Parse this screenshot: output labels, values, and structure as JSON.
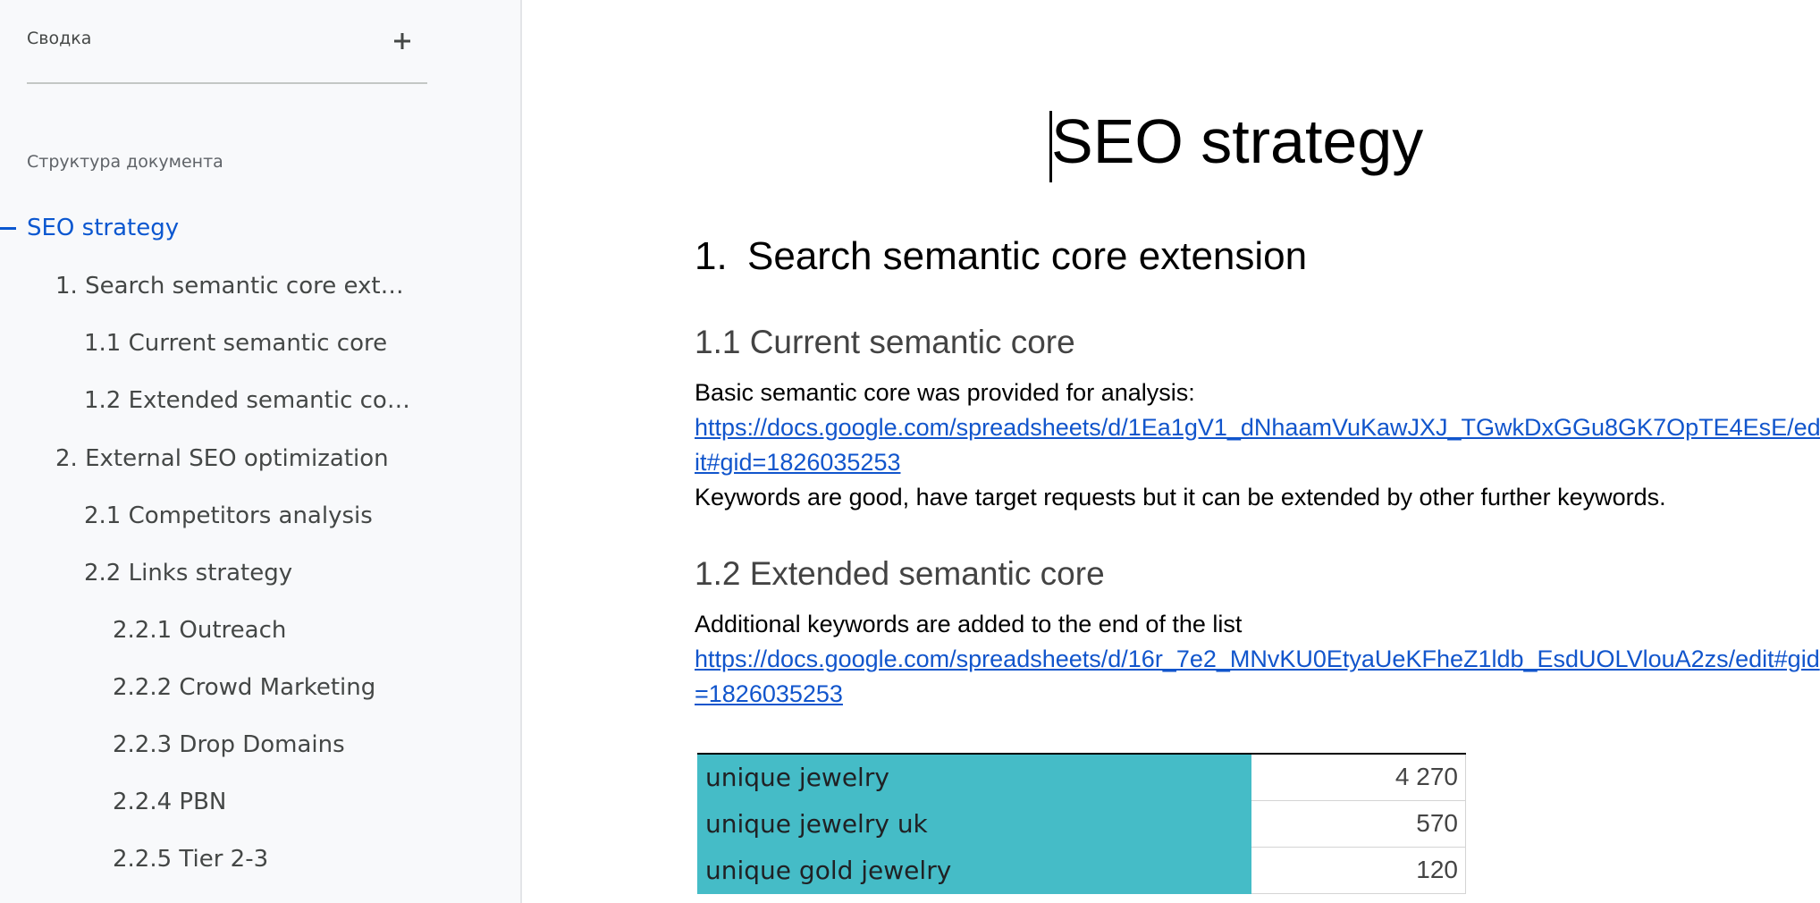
{
  "sidebar": {
    "summary_label": "Сводка",
    "add_icon": "plus-icon",
    "outline_title": "Структура документа",
    "outline": [
      {
        "label": "SEO strategy",
        "level": 0,
        "active": true
      },
      {
        "label": "1. Search semantic core ext…",
        "level": 1
      },
      {
        "label": "1.1 Current semantic core",
        "level": 2
      },
      {
        "label": "1.2 Extended semantic co…",
        "level": 2
      },
      {
        "label": "2. External SEO optimization",
        "level": 1
      },
      {
        "label": "2.1 Competitors analysis",
        "level": 2
      },
      {
        "label": "2.2 Links strategy",
        "level": 2
      },
      {
        "label": "2.2.1 Outreach",
        "level": 3
      },
      {
        "label": "2.2.2 Crowd Marketing",
        "level": 3
      },
      {
        "label": "2.2.3 Drop Domains",
        "level": 3
      },
      {
        "label": "2.2.4 PBN",
        "level": 3
      },
      {
        "label": "2.2.5 Tier 2-3",
        "level": 3
      }
    ],
    "active_color": "#0b57d0"
  },
  "document": {
    "title": "SEO strategy",
    "section1": {
      "number": "1.",
      "heading": "Search semantic core extension"
    },
    "section1_1": {
      "heading": "1.1 Current semantic core",
      "intro": "Basic semantic core was provided for analysis:",
      "link": "https://docs.google.com/spreadsheets/d/1Ea1gV1_dNhaamVuKawJXJ_TGwkDxGGu8GK7OpTE4EsE/edit#gid=1826035253",
      "note": "Keywords are good, have target requests but it can be extended by other further keywords."
    },
    "section1_2": {
      "heading": "1.2 Extended semantic core",
      "intro": "Additional keywords are added to the end of the list",
      "link": "https://docs.google.com/spreadsheets/d/16r_7e2_MNvKU0EtyaUeKFheZ1ldb_EsdUOLVlouA2zs/edit#gid=1826035253"
    },
    "keywords_table": [
      {
        "keyword": "unique jewelry",
        "volume": "4 270"
      },
      {
        "keyword": "unique jewelry uk",
        "volume": "570"
      },
      {
        "keyword": "unique gold jewelry",
        "volume": "120"
      }
    ],
    "link_color": "#1155cc",
    "table_fill_color": "#45bcc7"
  }
}
